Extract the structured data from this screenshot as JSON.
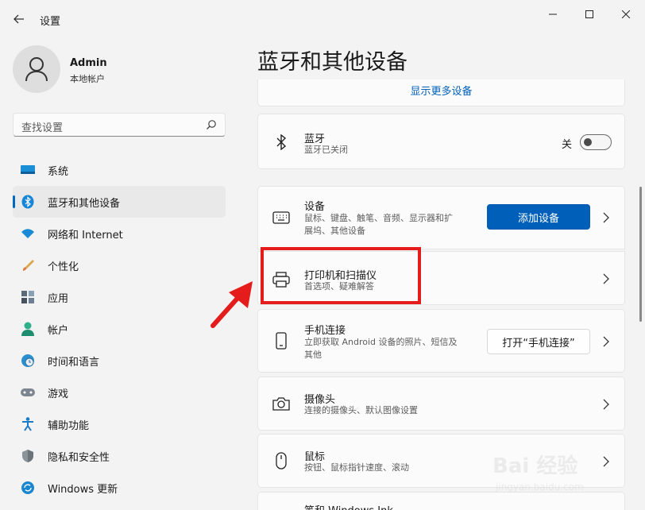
{
  "titlebar": {
    "title": "设置"
  },
  "user": {
    "name": "Admin",
    "account_type": "本地帐户"
  },
  "search": {
    "placeholder": "查找设置"
  },
  "nav": [
    {
      "label": "系统",
      "icon": "monitor-icon"
    },
    {
      "label": "蓝牙和其他设备",
      "icon": "bluetooth-icon",
      "active": true
    },
    {
      "label": "网络和 Internet",
      "icon": "wifi-icon"
    },
    {
      "label": "个性化",
      "icon": "brush-icon"
    },
    {
      "label": "应用",
      "icon": "apps-icon"
    },
    {
      "label": "帐户",
      "icon": "person-icon"
    },
    {
      "label": "时间和语言",
      "icon": "globe-clock-icon"
    },
    {
      "label": "游戏",
      "icon": "gamepad-icon"
    },
    {
      "label": "辅助功能",
      "icon": "accessibility-icon"
    },
    {
      "label": "隐私和安全性",
      "icon": "shield-icon"
    },
    {
      "label": "Windows 更新",
      "icon": "update-icon"
    }
  ],
  "main": {
    "page_title": "蓝牙和其他设备",
    "show_more": "显示更多设备",
    "bluetooth": {
      "title": "蓝牙",
      "subtitle": "蓝牙已关闭",
      "toggle_label": "关",
      "enabled": false
    },
    "devices": {
      "title": "设备",
      "subtitle_line1": "鼠标、键盘、触笔、音频、显示器和扩",
      "subtitle_line2": "展坞、其他设备",
      "button": "添加设备"
    },
    "printers": {
      "title": "打印机和扫描仪",
      "subtitle": "首选项、疑难解答"
    },
    "phone": {
      "title": "手机连接",
      "subtitle_line1": "立即获取 Android 设备的照片、短信及",
      "subtitle_line2": "其他",
      "button": "打开“手机连接”"
    },
    "camera": {
      "title": "摄像头",
      "subtitle": "连接的摄像头、默认图像设置"
    },
    "mouse": {
      "title": "鼠标",
      "subtitle": "按钮、鼠标指针速度、滚动"
    },
    "pen": {
      "title": "笔和 Windows Ink"
    }
  },
  "watermark": {
    "text": "Bai 经验",
    "url": "jingyan.baidu.com"
  },
  "colors": {
    "accent": "#005fb8",
    "highlight": "#e51c1c"
  }
}
